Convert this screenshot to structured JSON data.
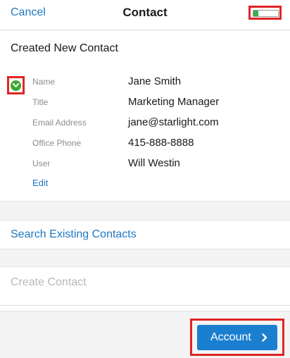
{
  "header": {
    "cancel_label": "Cancel",
    "title": "Contact",
    "progress_fraction": 0.2
  },
  "section": {
    "title": "Created New Contact"
  },
  "contact_fields": [
    {
      "label": "Name",
      "value": "Jane Smith"
    },
    {
      "label": "Title",
      "value": "Marketing Manager"
    },
    {
      "label": "Email Address",
      "value": "jane@starlight.com"
    },
    {
      "label": "Office Phone",
      "value": "415-888-8888"
    },
    {
      "label": "User",
      "value": "Will Westin"
    }
  ],
  "edit_label": "Edit",
  "search_existing_label": "Search Existing Contacts",
  "create_contact_label": "Create Contact",
  "footer": {
    "account_button_label": "Account"
  },
  "icons": {
    "check": "check-circle-icon",
    "chevron": "chevron-right-icon"
  },
  "colors": {
    "accent": "#1f78c1",
    "button": "#1b7fcf",
    "check": "#3aa835",
    "highlight": "#e02424",
    "progress": "#35b04a"
  }
}
